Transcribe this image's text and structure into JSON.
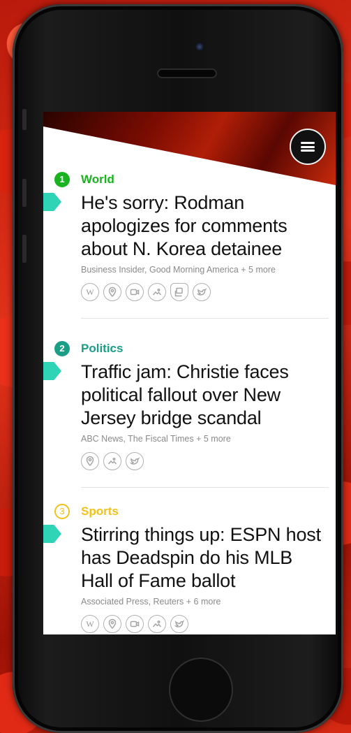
{
  "articles": [
    {
      "number": "1",
      "category": "World",
      "color": "#18b31e",
      "number_style": "filled",
      "title": "He's sorry: Rodman apologizes for comments about N. Korea detainee",
      "sources": "Business Insider, Good Morning America + 5 more",
      "icons": [
        "wikipedia-icon",
        "location-icon",
        "video-icon",
        "photos-icon",
        "related-icon",
        "twitter-icon"
      ]
    },
    {
      "number": "2",
      "category": "Politics",
      "color": "#1c9e86",
      "number_style": "filled",
      "title": "Traffic jam: Christie faces political fallout over New Jersey bridge scandal",
      "sources": "ABC News, The Fiscal Times + 5 more",
      "icons": [
        "location-icon",
        "photos-icon",
        "twitter-icon"
      ]
    },
    {
      "number": "3",
      "category": "Sports",
      "color": "#f2c21b",
      "number_style": "outline",
      "title": "Stirring things up: ESPN host has Deadspin do his MLB Hall of Fame ballot",
      "sources": "Associated Press, Reuters + 6 more",
      "icons": [
        "wikipedia-icon",
        "location-icon",
        "video-icon",
        "photos-icon",
        "twitter-icon"
      ]
    }
  ],
  "accent_flag_color": "#2fd3b6",
  "menu_icon": "hamburger-menu-icon"
}
